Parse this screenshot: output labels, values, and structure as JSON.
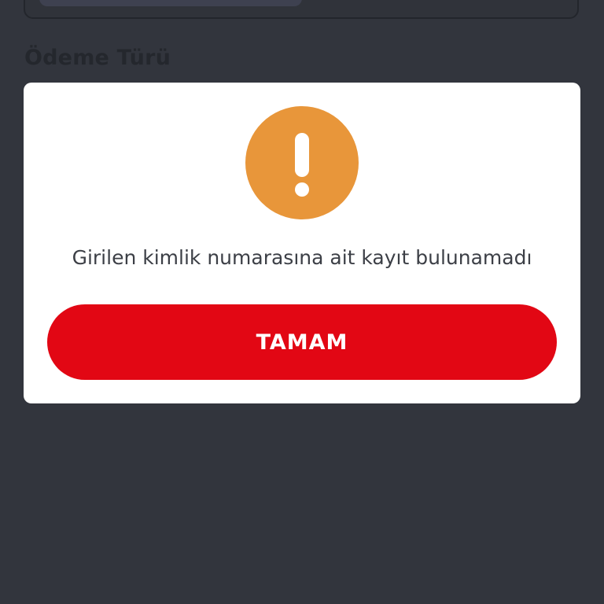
{
  "background": {
    "section_heading": "Ödeme Türü"
  },
  "dialog": {
    "icon": "exclamation-warning-icon",
    "icon_color": "#e8963a",
    "message": "Girilen kimlik numarasına ait kayıt bulunamadı",
    "ok_label": "TAMAM",
    "button_color": "#e20714"
  }
}
